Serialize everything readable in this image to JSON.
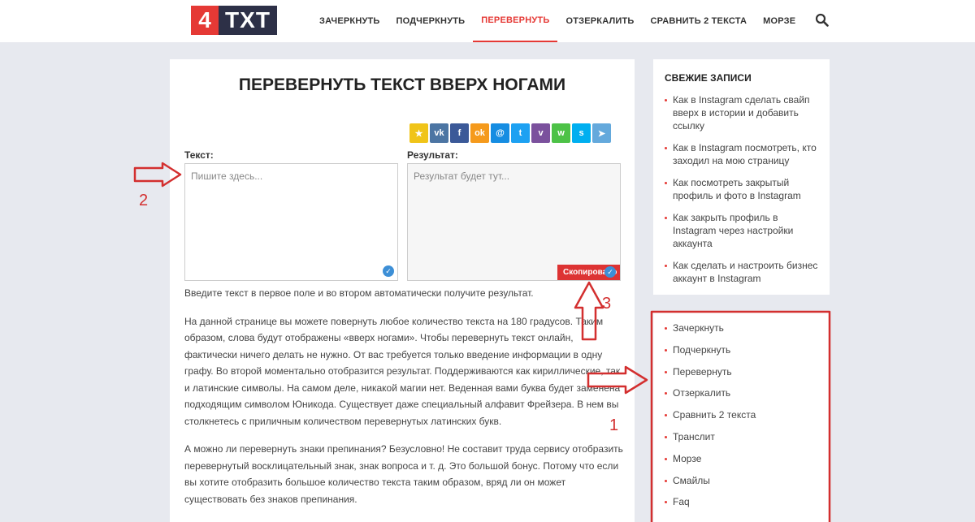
{
  "header": {
    "logo_num": "4",
    "logo_txt": "TXT",
    "nav": [
      "ЗАЧЕРКНУТЬ",
      "ПОДЧЕРКНУТЬ",
      "ПЕРЕВЕРНУТЬ",
      "ОТЗЕРКАЛИТЬ",
      "СРАВНИТЬ 2 ТЕКСТА",
      "МОРЗЕ"
    ],
    "active_nav": "ПЕРЕВЕРНУТЬ",
    "search_icon": "search-icon"
  },
  "main": {
    "title": "ПЕРЕВЕРНУТЬ ТЕКСТ ВВЕРХ НОГАМИ",
    "share": [
      {
        "icon": "bookmark-star-icon",
        "glyph": "★",
        "color": "#f0c419"
      },
      {
        "icon": "vk-icon",
        "glyph": "vk",
        "color": "#4c75a3"
      },
      {
        "icon": "facebook-icon",
        "glyph": "f",
        "color": "#3b5998"
      },
      {
        "icon": "odnoklassniki-icon",
        "glyph": "ok",
        "color": "#f59a1c"
      },
      {
        "icon": "moimir-icon",
        "glyph": "@",
        "color": "#168de2"
      },
      {
        "icon": "twitter-icon",
        "glyph": "t",
        "color": "#1da1f2"
      },
      {
        "icon": "viber-icon",
        "glyph": "v",
        "color": "#7b519d"
      },
      {
        "icon": "whatsapp-icon",
        "glyph": "w",
        "color": "#4dc247"
      },
      {
        "icon": "skype-icon",
        "glyph": "s",
        "color": "#00aff0"
      },
      {
        "icon": "telegram-icon",
        "glyph": "➤",
        "color": "#64a9dc"
      }
    ],
    "input_label": "Текст:",
    "input_placeholder": "Пишите здесь...",
    "result_label": "Результат:",
    "result_placeholder": "Результат будет тут...",
    "copied_label": "Скопировано",
    "article": [
      "Введите текст в первое поле и во втором автоматически получите результат.",
      "На данной странице вы можете повернуть любое количество текста на 180 градусов. Таким образом, слова будут отображены «вверх ногами». Чтобы перевернуть текст онлайн, фактически ничего делать не нужно. От вас требуется только введение информации в одну графу. Во второй моментально отобразится результат. Поддерживаются как кириллические, так и латинские символы. На самом деле, никакой магии нет. Веденная вами буква будет заменена подходящим символом Юникода. Существует даже специальный алфавит Фрейзера. В нем вы столкнетесь с приличным количеством перевернутых латинских букв.",
      "А можно ли перевернуть знаки препинания? Безусловно! Не составит труда сервису отобразить перевернутый восклицательный знак, знак вопроса и т. д. Это большой бонус. Потому что если вы хотите отобразить большое количество текста таким образом, вряд ли он может существовать без знаков препинания."
    ]
  },
  "sidebar": {
    "recent_title": "СВЕЖИЕ ЗАПИСИ",
    "recent": [
      "Как в Instagram сделать свайп вверх в истории и добавить ссылку",
      "Как в Instagram посмотреть, кто заходил на мою страницу",
      "Как посмотреть закрытый профиль и фото в Instagram",
      "Как закрыть профиль в Instagram через настройки аккаунта",
      "Как сделать и настроить бизнес аккаунт в Instagram"
    ],
    "links": [
      "Зачеркнуть",
      "Подчеркнуть",
      "Перевернуть",
      "Отзеркалить",
      "Сравнить 2 текста",
      "Транслит",
      "Морзе",
      "Смайлы",
      "Faq"
    ]
  },
  "annotations": {
    "label_1": "1",
    "label_2": "2",
    "label_3": "3",
    "color": "#d32f2f"
  }
}
